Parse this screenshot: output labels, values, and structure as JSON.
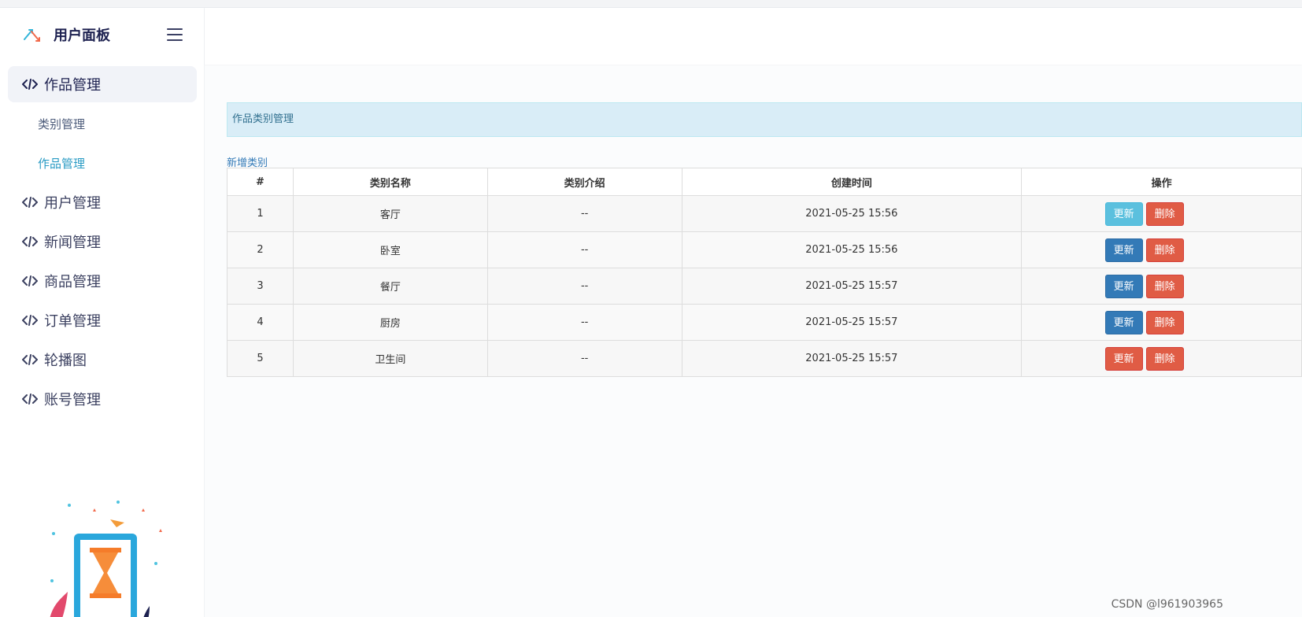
{
  "brand": {
    "title": "用户面板"
  },
  "sidebar": {
    "menu": [
      {
        "label": "作品管理",
        "active": true
      },
      {
        "label": "用户管理"
      },
      {
        "label": "新闻管理"
      },
      {
        "label": "商品管理"
      },
      {
        "label": "订单管理"
      },
      {
        "label": "轮播图"
      },
      {
        "label": "账号管理"
      }
    ],
    "submenu": [
      {
        "label": "类别管理"
      },
      {
        "label": "作品管理"
      }
    ]
  },
  "main": {
    "panel_title": "作品类别管理",
    "add_link": "新增类别",
    "table": {
      "headers": [
        "#",
        "类别名称",
        "类别介绍",
        "创建时间",
        "操作"
      ],
      "rows": [
        {
          "num": "1",
          "name": "客厅",
          "desc": "--",
          "created": "2021-05-25 15:56",
          "update": "更新",
          "delete": "删除",
          "update_style": "info"
        },
        {
          "num": "2",
          "name": "卧室",
          "desc": "--",
          "created": "2021-05-25 15:56",
          "update": "更新",
          "delete": "删除",
          "update_style": "primary"
        },
        {
          "num": "3",
          "name": "餐厅",
          "desc": "--",
          "created": "2021-05-25 15:57",
          "update": "更新",
          "delete": "删除",
          "update_style": "primary"
        },
        {
          "num": "4",
          "name": "厨房",
          "desc": "--",
          "created": "2021-05-25 15:57",
          "update": "更新",
          "delete": "删除",
          "update_style": "primary"
        },
        {
          "num": "5",
          "name": "卫生间",
          "desc": "--",
          "created": "2021-05-25 15:57",
          "update": "更新",
          "delete": "删除",
          "update_style": "danger"
        }
      ]
    }
  },
  "watermark": "CSDN @l961903965",
  "icons": {
    "logo": "brand-arrows-icon",
    "menu_toggle": "hamburger-icon",
    "menu_item": "code-icon"
  },
  "colors": {
    "accent": "#2a9bc4",
    "panel_heading_bg": "#d9edf7",
    "btn_info": "#5bc0de",
    "btn_primary": "#337ab7",
    "btn_danger": "#e05c45"
  }
}
